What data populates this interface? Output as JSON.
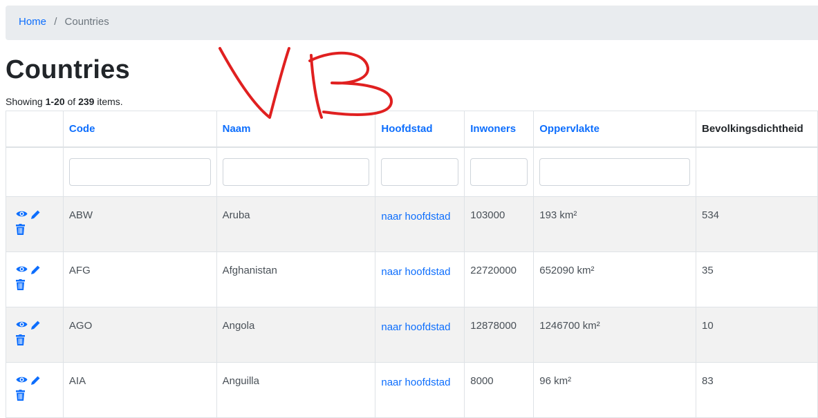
{
  "breadcrumb": {
    "home": "Home",
    "separator": "/",
    "current": "Countries"
  },
  "page": {
    "title": "Countries"
  },
  "summary": {
    "prefix": "Showing ",
    "range": "1-20",
    "of": " of ",
    "total": "239",
    "suffix": " items."
  },
  "table": {
    "columns": {
      "code": "Code",
      "naam": "Naam",
      "hoofdstad": "Hoofdstad",
      "inwoners": "Inwoners",
      "oppervlakte": "Oppervlakte",
      "dichtheid": "Bevolkingsdichtheid"
    },
    "rows": [
      {
        "code": "ABW",
        "naam": "Aruba",
        "hoofdstad": "naar hoofdstad",
        "inwoners": "103000",
        "oppervlakte": "193 km²",
        "dichtheid": "534"
      },
      {
        "code": "AFG",
        "naam": "Afghanistan",
        "hoofdstad": "naar hoofdstad",
        "inwoners": "22720000",
        "oppervlakte": "652090 km²",
        "dichtheid": "35"
      },
      {
        "code": "AGO",
        "naam": "Angola",
        "hoofdstad": "naar hoofdstad",
        "inwoners": "12878000",
        "oppervlakte": "1246700 km²",
        "dichtheid": "10"
      },
      {
        "code": "AIA",
        "naam": "Anguilla",
        "hoofdstad": "naar hoofdstad",
        "inwoners": "8000",
        "oppervlakte": "96 km²",
        "dichtheid": "83"
      }
    ]
  },
  "annotation": {
    "text": "VB",
    "color": "#e02020"
  },
  "colors": {
    "link": "#0d6efd",
    "breadcrumb_bg": "#e9ecef",
    "stripe": "#f2f2f2"
  },
  "icons": {
    "view": "eye-icon",
    "edit": "pencil-icon",
    "delete": "trash-icon"
  }
}
